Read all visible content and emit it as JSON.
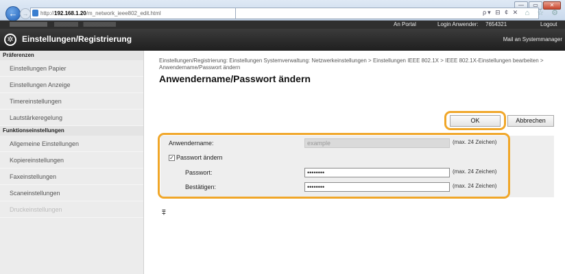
{
  "browser": {
    "url_prefix": "http://",
    "url_host": "192.168.1.20",
    "url_path": "/m_network_ieee802_edit.html",
    "search_tools": "ρ▾ ⊟ ¢ ✕",
    "window_buttons": [
      "—",
      "▭",
      "✕"
    ],
    "toolbar_icons": "⌂ ☆ ⚙"
  },
  "topbar": {
    "portal_link": "An Portal",
    "login_label": "Login Anwender:",
    "login_user": "7654321",
    "logout_link": "Logout"
  },
  "header": {
    "title": "Einstellungen/Registrierung",
    "mail_admin": "Mail an Systemmanager"
  },
  "sidebar": {
    "sections": [
      {
        "title": "Präferenzen",
        "items": [
          "Einstellungen Papier",
          "Einstellungen Anzeige",
          "Timereinstellungen",
          "Lautstärkeregelung"
        ]
      },
      {
        "title": "Funktionseinstellungen",
        "items": [
          "Allgemeine Einstellungen",
          "Kopiereinstellungen",
          "Faxeinstellungen",
          "Scaneinstellungen",
          "Druckeinstellungen"
        ]
      }
    ]
  },
  "main": {
    "breadcrumb": "Einstellungen/Registrierung: Einstellungen Systemverwaltung: Netzwerkeinstellungen > Einstellungen IEEE 802.1X > IEEE 802.1X-Einstellungen bearbeiten > Anwendername/Passwort ändern",
    "page_title": "Anwendername/Passwort ändern",
    "ok_label": "OK",
    "cancel_label": "Abbrechen",
    "form": {
      "username_label": "Anwendername:",
      "username_value": "example",
      "username_hint": "(max. 24 Zeichen)",
      "change_password_label": "Passwort ändern",
      "change_password_checked": true,
      "password_label": "Passwort:",
      "password_value": "••••••••",
      "password_hint": "(max. 24 Zeichen)",
      "confirm_label": "Bestätigen:",
      "confirm_value": "••••••••",
      "confirm_hint": "(max. 24 Zeichen)"
    },
    "to_top_icon": "⩱"
  },
  "colors": {
    "highlight_ring": "#f0a628",
    "header_bg": "#2b2b2b",
    "sidebar_bg": "#ececec"
  }
}
